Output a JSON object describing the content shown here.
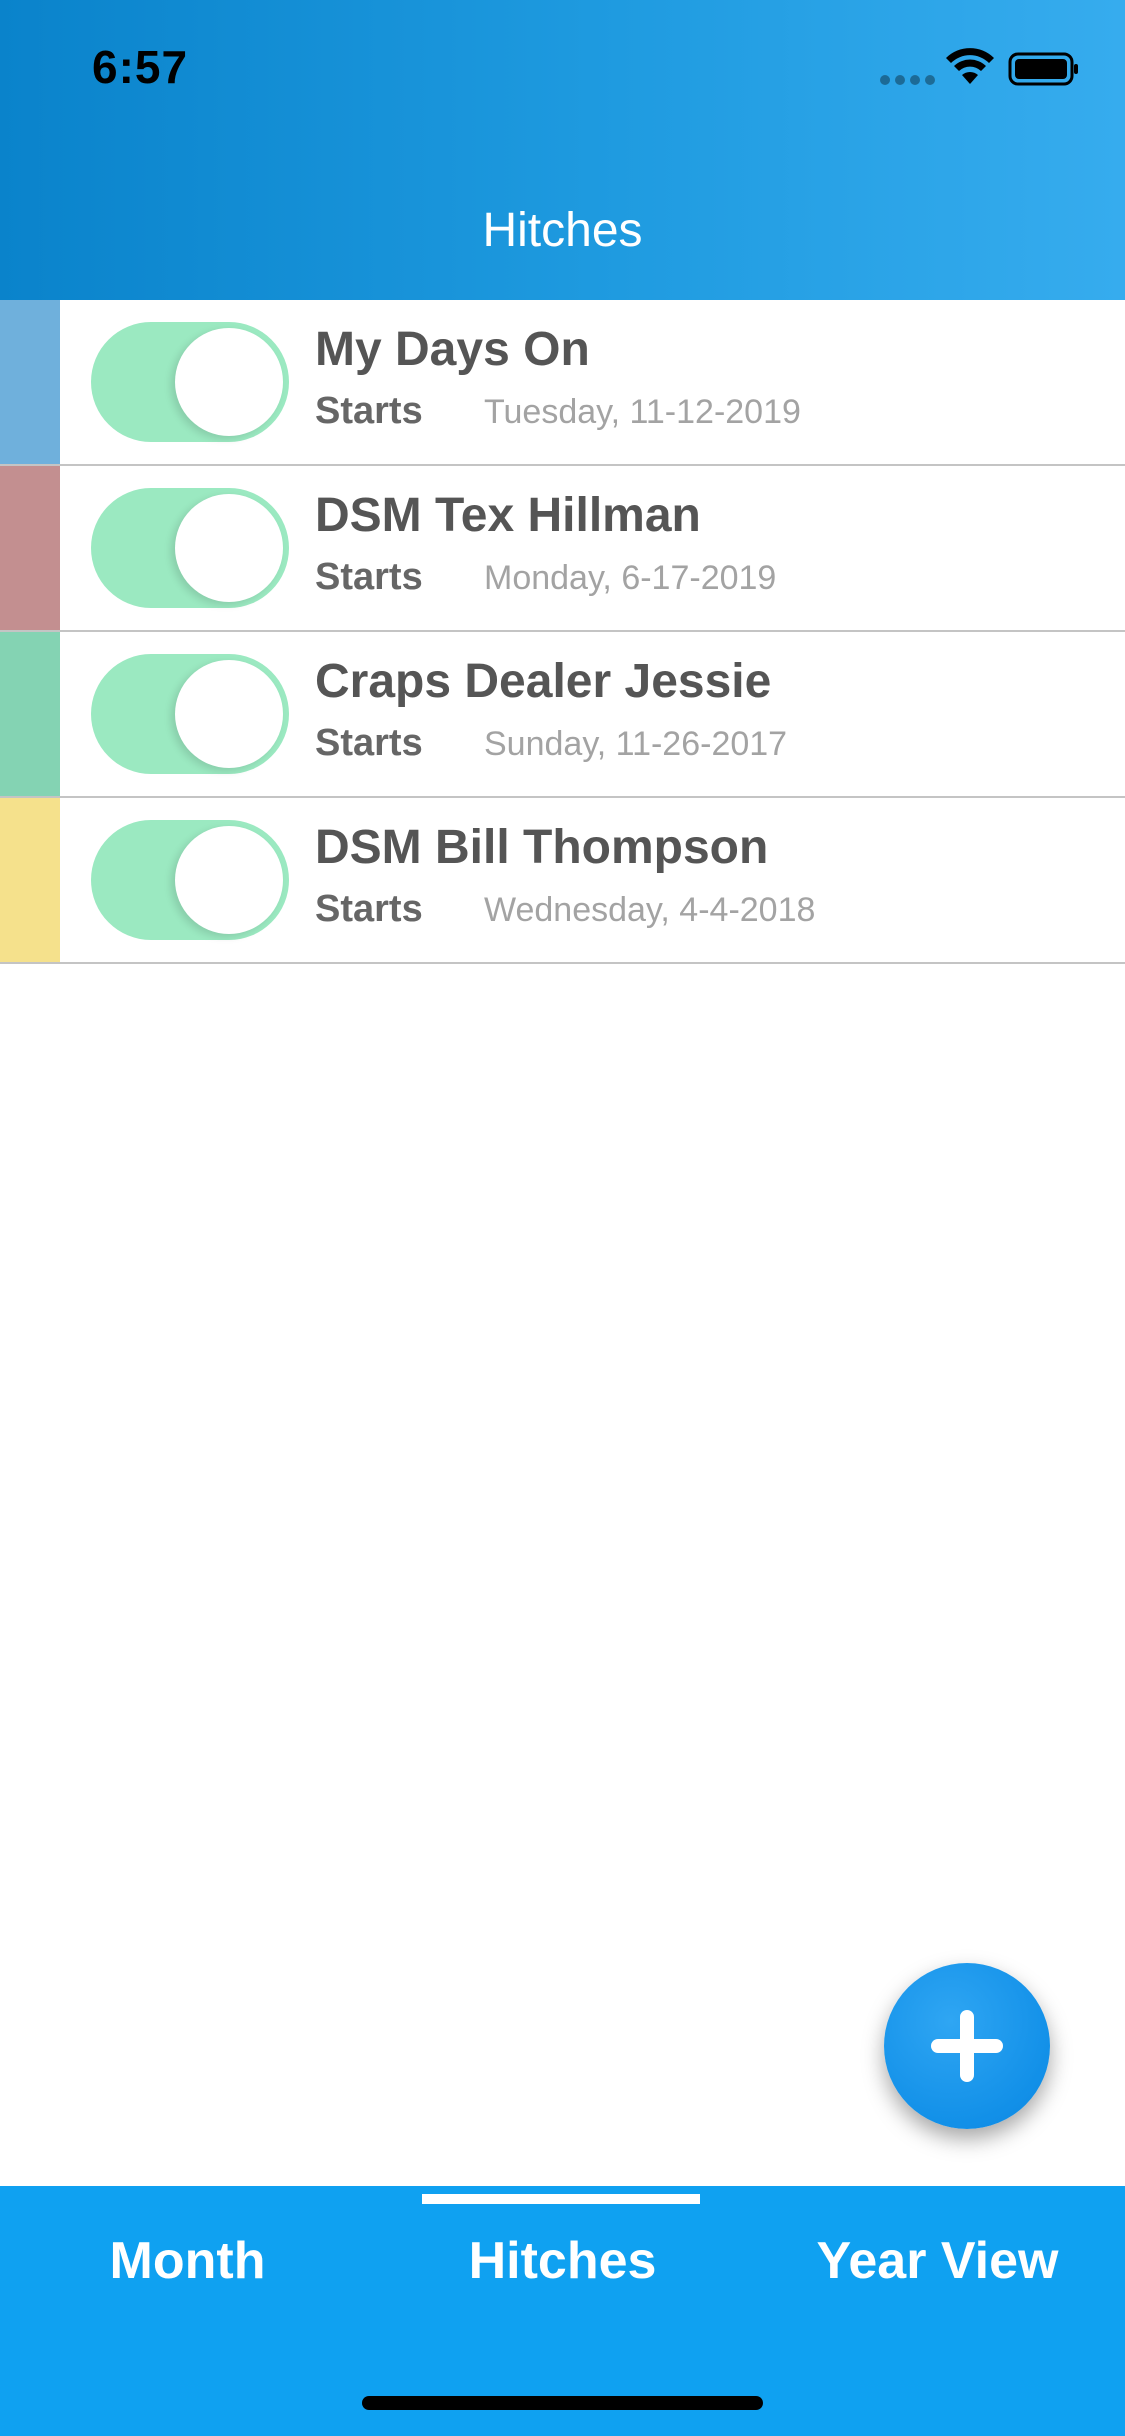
{
  "status_bar": {
    "time": "6:57"
  },
  "nav": {
    "title": "Hitches"
  },
  "hitches": [
    {
      "title": "My Days On",
      "starts_label": "Starts",
      "date": "Tuesday, 11-12-2019",
      "color": "#6fb0dc",
      "enabled": true
    },
    {
      "title": "DSM Tex Hillman",
      "starts_label": "Starts",
      "date": "Monday, 6-17-2019",
      "color": "#c38f90",
      "enabled": true
    },
    {
      "title": "Craps Dealer Jessie",
      "starts_label": "Starts",
      "date": "Sunday, 11-26-2017",
      "color": "#84d3b3",
      "enabled": true
    },
    {
      "title": "DSM Bill Thompson",
      "starts_label": "Starts",
      "date": "Wednesday, 4-4-2018",
      "color": "#f5e18c",
      "enabled": true
    }
  ],
  "fab": {
    "icon": "plus-icon"
  },
  "tabbar": {
    "tabs": [
      {
        "label": "Month"
      },
      {
        "label": "Hitches",
        "selected": true
      },
      {
        "label": "Year View"
      }
    ]
  },
  "colors": {
    "header_start": "#0a83cb",
    "header_end": "#36acee",
    "tabbar": "#0fa1f1",
    "toggle_on": "#9be9c1",
    "fab": "#1290e8"
  }
}
